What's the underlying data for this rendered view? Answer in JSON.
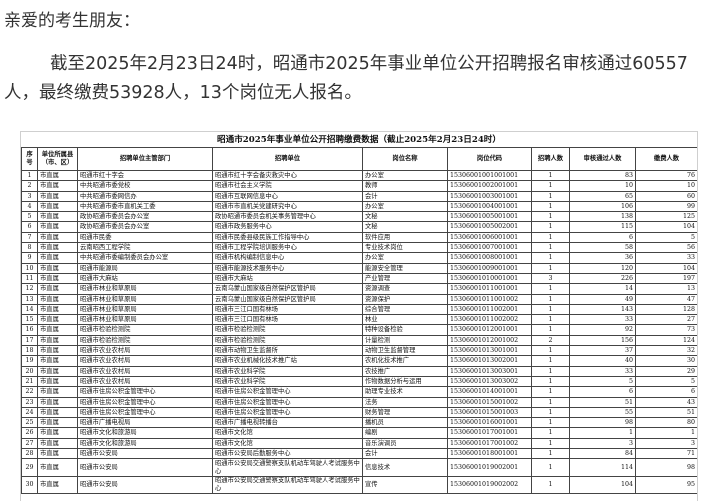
{
  "greeting": "亲爱的考生朋友：",
  "paragraph": "截至2025年2月23日24时，昭通市2025年事业单位公开招聘报名审核通过60557人，最终缴费53928人，13个岗位无人报名。",
  "doc_title": "昭通市2025年事业单位公开招聘缴费数据（截止2025年2月23日24时）",
  "headers": [
    "序号",
    "单位所属县（市、区）",
    "招聘单位主管部门",
    "招聘单位",
    "岗位名称",
    "岗位代码",
    "招聘人数",
    "审核通过人数",
    "缴费人数"
  ],
  "rows": [
    [
      "1",
      "市直属",
      "昭通市红十字会",
      "昭通市红十字会备灾救灾中心",
      "办公室",
      "15306001001001001",
      "1",
      "83",
      "76"
    ],
    [
      "2",
      "市直属",
      "中共昭通市委党校",
      "昭通市社会主义学院",
      "教师",
      "15306001002001001",
      "1",
      "10",
      "10"
    ],
    [
      "3",
      "市直属",
      "中共昭通市委网信办",
      "昭通市互联网信息中心",
      "会计",
      "15306001003001001",
      "1",
      "65",
      "60"
    ],
    [
      "4",
      "市直属",
      "中共昭通市委市直机关工委",
      "昭通市市直机关党建研究中心",
      "办公室",
      "15306001004001001",
      "1",
      "106",
      "99"
    ],
    [
      "5",
      "市直属",
      "政协昭通市委员会办公室",
      "政协昭通市委员会机关事务管理中心",
      "文秘",
      "15306001005001001",
      "1",
      "138",
      "125"
    ],
    [
      "6",
      "市直属",
      "政协昭通市委员会办公室",
      "昭通市政务服务中心",
      "文秘",
      "15306001005002001",
      "1",
      "115",
      "104"
    ],
    [
      "7",
      "市直属",
      "昭通市民委",
      "昭通市民委县级民族工作指导中心",
      "软件应用",
      "15306001006001001",
      "1",
      "6",
      "5"
    ],
    [
      "8",
      "市直属",
      "云南昭西工程学院",
      "昭通市工程学院培训服务中心",
      "专业技术岗位",
      "15306001007001001",
      "1",
      "58",
      "56"
    ],
    [
      "9",
      "市直属",
      "中共昭通市委编制委员会办公室",
      "昭通市机构编制信息中心",
      "办公室",
      "15306001008001001",
      "1",
      "36",
      "33"
    ],
    [
      "10",
      "市直属",
      "昭通市能源局",
      "昭通市能源技术服务中心",
      "能源安全管理",
      "15306001009001001",
      "1",
      "120",
      "104"
    ],
    [
      "11",
      "市直属",
      "昭通市大麻站",
      "昭通市大麻站",
      "产业管理",
      "15306001010001001",
      "3",
      "226",
      "197"
    ],
    [
      "12",
      "市直属",
      "昭通市林业和草原局",
      "云南乌蒙山国家级自然保护区管护局",
      "资源调查",
      "15306001011001001",
      "1",
      "14",
      "13"
    ],
    [
      "13",
      "市直属",
      "昭通市林业和草原局",
      "云南乌蒙山国家级自然保护区管护局",
      "资源保护",
      "15306001011001002",
      "1",
      "49",
      "47"
    ],
    [
      "14",
      "市直属",
      "昭通市林业和草原局",
      "昭通市三江口国有林场",
      "综合管理",
      "15306001011002001",
      "1",
      "143",
      "128"
    ],
    [
      "15",
      "市直属",
      "昭通市林业和草原局",
      "昭通市三江口国有林场",
      "林业",
      "15306001011002002",
      "1",
      "33",
      "27"
    ],
    [
      "16",
      "市直属",
      "昭通市检验检测院",
      "昭通市检验检测院",
      "特种设备检验",
      "15306001012001001",
      "1",
      "92",
      "73"
    ],
    [
      "17",
      "市直属",
      "昭通市检验检测院",
      "昭通市检验检测院",
      "计量检测",
      "15306001012001002",
      "2",
      "156",
      "124"
    ],
    [
      "18",
      "市直属",
      "昭通市农业农村局",
      "昭通市动物卫生监督所",
      "动物卫生监督管理",
      "15306001013001001",
      "1",
      "37",
      "32"
    ],
    [
      "19",
      "市直属",
      "昭通市农业农村局",
      "昭通市农业机械化技术推广站",
      "农机化技术推广",
      "15306001013002001",
      "1",
      "40",
      "30"
    ],
    [
      "20",
      "市直属",
      "昭通市农业农村局",
      "昭通市农业科学院",
      "农技推广",
      "15306001013003001",
      "1",
      "33",
      "29"
    ],
    [
      "21",
      "市直属",
      "昭通市农业农村局",
      "昭通市农业科学院",
      "作物数据分析与运用",
      "15306001013003002",
      "1",
      "5",
      "5"
    ],
    [
      "22",
      "市直属",
      "昭通市住房公积金管理中心",
      "昭通市住房公积金管理中心",
      "助理专业技术",
      "15306001014001001",
      "1",
      "6",
      "6"
    ],
    [
      "23",
      "市直属",
      "昭通市住房公积金管理中心",
      "昭通市住房公积金管理中心",
      "法务",
      "15306001015001002",
      "1",
      "51",
      "43"
    ],
    [
      "24",
      "市直属",
      "昭通市住房公积金管理中心",
      "昭通市住房公积金管理中心",
      "财务管理",
      "15306001015001003",
      "1",
      "55",
      "51"
    ],
    [
      "25",
      "市直属",
      "昭通市广播电视局",
      "昭通市广播电视转播台",
      "播机员",
      "15306001016001001",
      "1",
      "98",
      "80"
    ],
    [
      "26",
      "市直属",
      "昭通市文化和旅游局",
      "昭通市文化馆",
      "编剧",
      "15306001017001001",
      "1",
      "1",
      "1"
    ],
    [
      "27",
      "市直属",
      "昭通市文化和旅游局",
      "昭通市文化馆",
      "音乐演调员",
      "15306001017001002",
      "1",
      "3",
      "3"
    ],
    [
      "28",
      "市直属",
      "昭通市公安局",
      "昭通市公安局后勤服务中心",
      "会计",
      "15306001018001001",
      "1",
      "84",
      "71"
    ],
    [
      "29",
      "市直属",
      "昭通市公安局",
      "昭通市公安局交通警察支队机动车驾驶人考试服务中心",
      "信息技术",
      "15306001019002001",
      "1",
      "114",
      "98"
    ],
    [
      "30",
      "市直属",
      "昭通市公安局",
      "昭通市公安局交通警察支队机动车驾驶人考试服务中心",
      "宣传",
      "15306001019002002",
      "1",
      "104",
      "95"
    ]
  ]
}
